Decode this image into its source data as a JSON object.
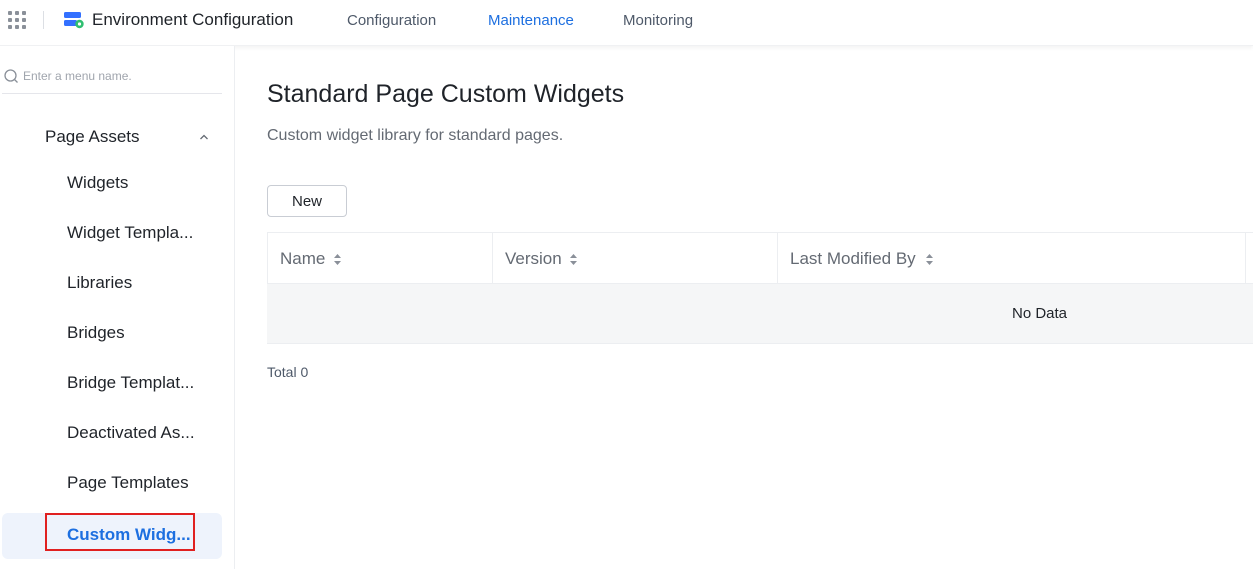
{
  "header": {
    "app_title": "Environment Configuration",
    "tabs": [
      {
        "label": "Configuration",
        "active": false
      },
      {
        "label": "Maintenance",
        "active": true
      },
      {
        "label": "Monitoring",
        "active": false
      }
    ],
    "accent_color": "#1d6fe0"
  },
  "sidebar": {
    "search_placeholder": "Enter a menu name.",
    "group": {
      "label": "Page Assets",
      "expanded": true
    },
    "items": [
      {
        "label": "Widgets",
        "active": false
      },
      {
        "label": "Widget Templa...",
        "active": false
      },
      {
        "label": "Libraries",
        "active": false
      },
      {
        "label": "Bridges",
        "active": false
      },
      {
        "label": "Bridge Templat...",
        "active": false
      },
      {
        "label": "Deactivated As...",
        "active": false
      },
      {
        "label": "Page Templates",
        "active": false
      },
      {
        "label": "Custom Widg...",
        "active": true
      }
    ]
  },
  "main": {
    "title": "Standard Page Custom Widgets",
    "description": "Custom widget library for standard pages.",
    "new_button": "New",
    "table": {
      "columns": [
        "Name",
        "Version",
        "Last Modified By"
      ],
      "empty_text": "No Data"
    },
    "total": "Total 0"
  }
}
